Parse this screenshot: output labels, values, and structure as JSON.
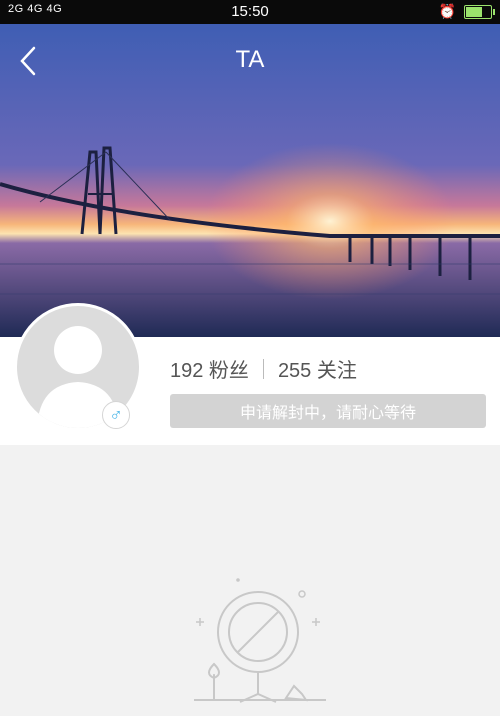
{
  "status_bar": {
    "network": "2G 4G 4G",
    "time": "15:50"
  },
  "header": {
    "title": "TA",
    "back_icon": "chevron-left-icon"
  },
  "profile": {
    "followers": "192 粉丝",
    "following": "255 关注",
    "gender_icon": "male-icon",
    "status_button_label": "申请解封中，请耐心等待"
  },
  "colors": {
    "accent_gender": "#4ab6e8",
    "button_disabled": "#d3d3d3",
    "battery": "#9be36c"
  }
}
